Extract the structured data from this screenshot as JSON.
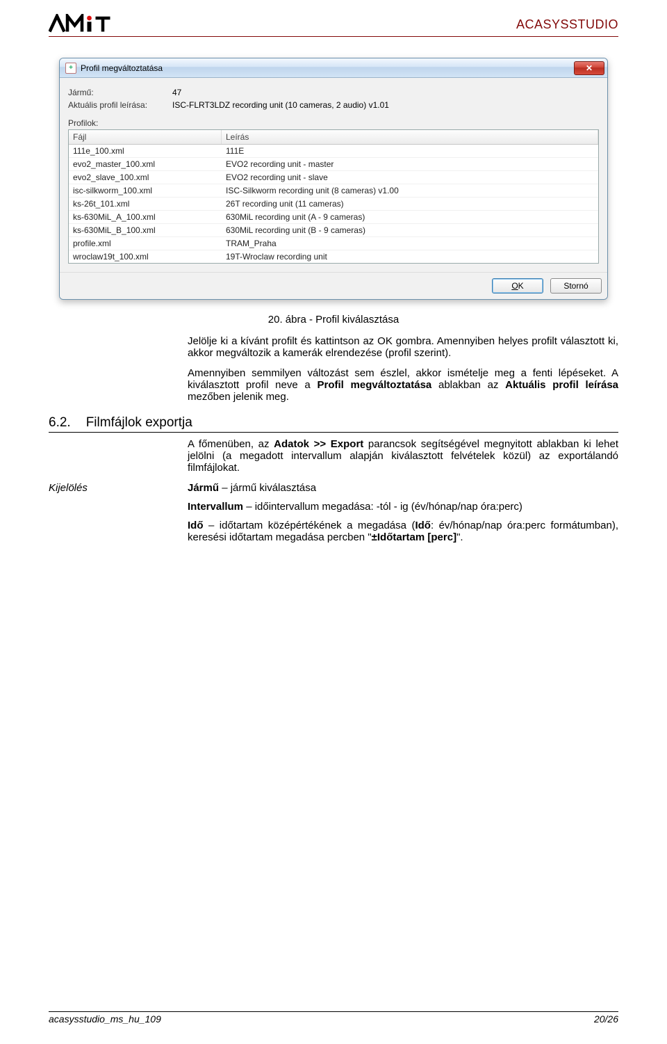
{
  "header": {
    "brand": "ACASYSSTUDIO"
  },
  "dialog": {
    "title": "Profil megváltoztatása",
    "vehicle_label": "Jármű:",
    "vehicle_value": "47",
    "desc_label": "Aktuális profil leírása:",
    "desc_value": "ISC-FLRT3LDZ recording unit (10 cameras, 2 audio) v1.01",
    "profiles_label": "Profilok:",
    "columns": {
      "file": "Fájl",
      "desc": "Leírás"
    },
    "rows": [
      {
        "file": "111e_100.xml",
        "desc": "111E"
      },
      {
        "file": "evo2_master_100.xml",
        "desc": "EVO2 recording unit - master"
      },
      {
        "file": "evo2_slave_100.xml",
        "desc": "EVO2 recording unit - slave"
      },
      {
        "file": "isc-silkworm_100.xml",
        "desc": "ISC-Silkworm recording unit (8 cameras) v1.00"
      },
      {
        "file": "ks-26t_101.xml",
        "desc": "26T recording unit (11 cameras)"
      },
      {
        "file": "ks-630MiL_A_100.xml",
        "desc": "630MiL recording unit (A - 9 cameras)"
      },
      {
        "file": "ks-630MiL_B_100.xml",
        "desc": "630MiL recording unit (B - 9 cameras)"
      },
      {
        "file": "profile.xml",
        "desc": "TRAM_Praha"
      },
      {
        "file": "wroclaw19t_100.xml",
        "desc": "19T-Wroclaw recording unit"
      }
    ],
    "ok_btn": "OK",
    "cancel_btn": "Stornó"
  },
  "doc": {
    "figcap": "20. ábra -  Profil kiválasztása",
    "p1": "Jelölje ki a kívánt profilt és kattintson az OK gombra. Amennyiben helyes profilt választott ki, akkor megváltozik a kamerák elrendezése (profil szerint).",
    "p2a": "Amennyiben semmilyen változást sem észlel, akkor ismételje meg a fenti lépéseket. A kiválasztott profil neve a ",
    "p2b": "Profil megváltoztatása",
    "p2c": " ablakban az ",
    "p2d": "Aktuális profil leírása",
    "p2e": " mezőben jelenik meg.",
    "sec_num": "6.2.",
    "sec_title": "Filmfájlok exportja",
    "p3a": "A főmenüben, az ",
    "p3b": "Adatok >> Export",
    "p3c": " parancsok segítségével megnyitott ablakban ki lehet jelölni (a megadott intervallum alapján kiválasztott felvételek közül) az exportálandó filmfájlokat.",
    "kijel_label": "Kijelölés",
    "k1a": "Jármű",
    "k1b": " – jármű kiválasztása",
    "k2a": "Intervallum",
    "k2b": " – időintervallum megadása: -tól - ig (év/hónap/nap óra:perc)",
    "k3a": "Idő",
    "k3b": " – időtartam középértékének a megadása (",
    "k3c": "Idő",
    "k3d": ": év/hónap/nap óra:perc formátumban), keresési időtartam megadása percben \"",
    "k3e": "±Időtartam [perc]",
    "k3f": "\"."
  },
  "footer": {
    "left": "acasysstudio_ms_hu_109",
    "right": "20/26"
  }
}
